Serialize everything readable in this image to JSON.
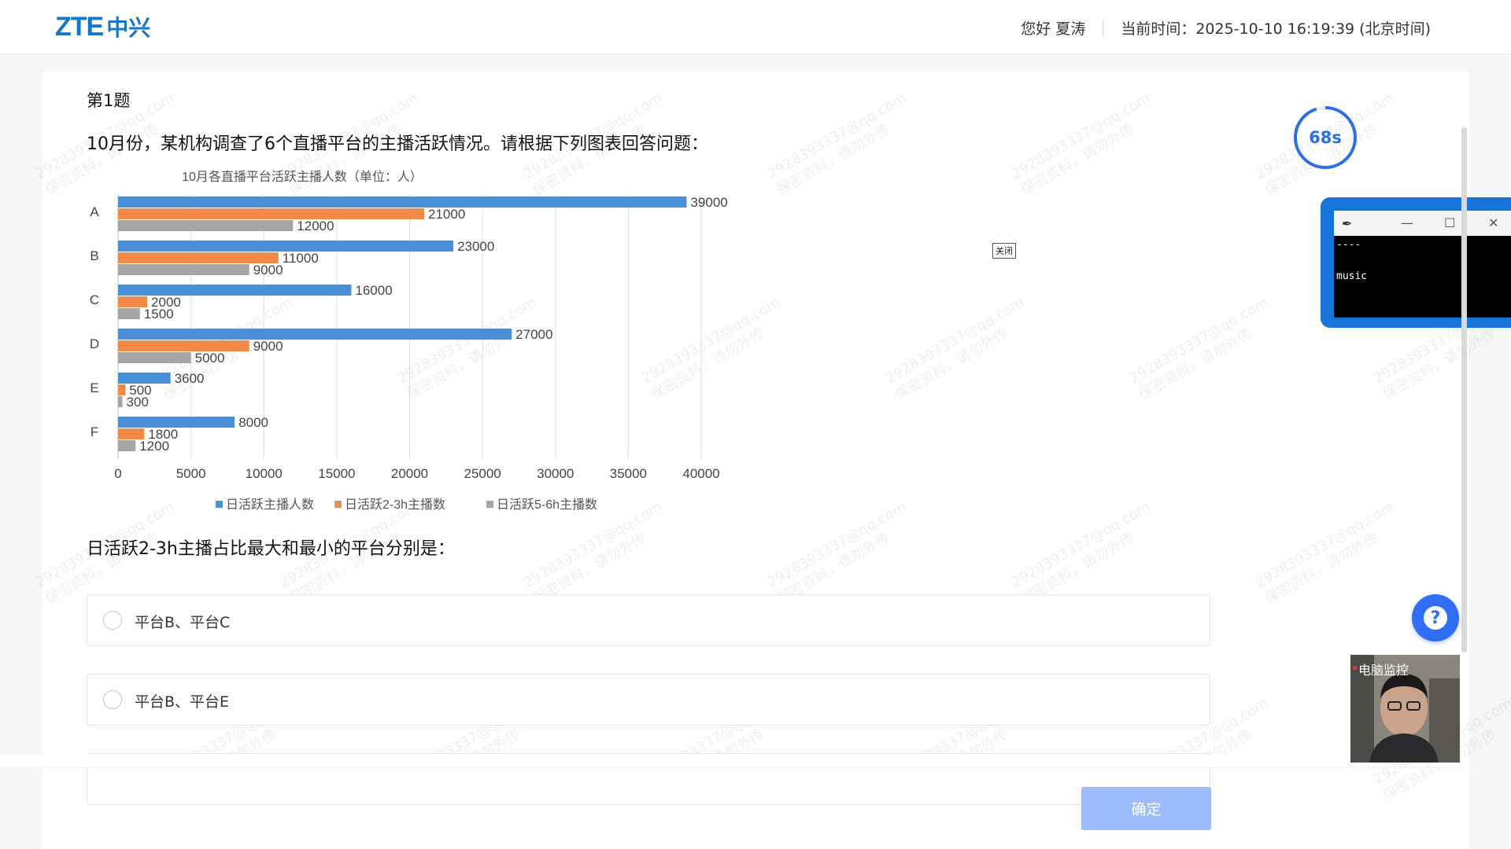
{
  "header": {
    "brand_latin": "ZTE",
    "brand_cn": "中兴",
    "greeting": "您好 夏涛",
    "time_label": "当前时间：2025-10-10 16:19:39 (北京时间)"
  },
  "question": {
    "number_label": "第1题",
    "stem": "10月份，某机构调查了6个直播平台的主播活跃情况。请根据下列图表回答问题：",
    "ask": "日活跃2-3h主播占比最大和最小的平台分别是：",
    "options": [
      {
        "label": "平台B、平台C",
        "selected": false
      },
      {
        "label": "平台B、平台E",
        "selected": false
      }
    ]
  },
  "timer": {
    "label": "68s",
    "progress": 0.95,
    "color": "#2a6fe8"
  },
  "confirm_label": "确定",
  "close_label": "关闭",
  "terminal": {
    "line1": "----",
    "line2": "music"
  },
  "webcam_label": "电脑监控",
  "watermark": {
    "line1": "2928393337@qq.com",
    "line2": "保密资料，请勿外传"
  },
  "colors": {
    "brand": "#1677c8",
    "accent": "#2f6ef5",
    "confirm_bg": "#9cbcfd"
  },
  "chart_data": {
    "type": "bar",
    "orientation": "horizontal",
    "title": "10月各直播平台活跃主播人数（单位：人）",
    "categories": [
      "A",
      "B",
      "C",
      "D",
      "E",
      "F"
    ],
    "series": [
      {
        "name": "日活跃主播人数",
        "color": "#4a8fd6",
        "values": [
          39000,
          23000,
          16000,
          27000,
          3600,
          8000
        ]
      },
      {
        "name": "日活跃2-3h主播数",
        "color": "#f08a46",
        "values": [
          21000,
          11000,
          2000,
          9000,
          500,
          1800
        ]
      },
      {
        "name": "日活跃5-6h主播数",
        "color": "#a5a5a5",
        "values": [
          12000,
          9000,
          1500,
          5000,
          300,
          1200
        ]
      }
    ],
    "xlim": [
      0,
      40000
    ],
    "xticks": [
      "0",
      "5000",
      "10000",
      "15000",
      "20000",
      "25000",
      "30000",
      "35000",
      "40000"
    ],
    "grid": true,
    "legend_position": "bottom"
  }
}
